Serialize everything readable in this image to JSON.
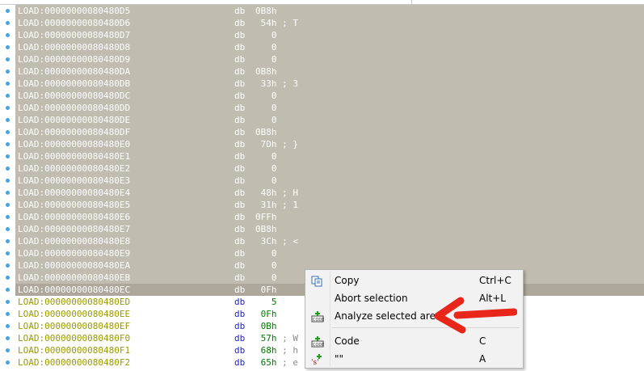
{
  "listing": {
    "rows": [
      {
        "addr": "LOAD:00000000080480D5",
        "mnemonic": "db",
        "operand": "0B8h",
        "comment": "",
        "state": "sel"
      },
      {
        "addr": "LOAD:00000000080480D6",
        "mnemonic": "db",
        "operand": " 54h",
        "comment": " ; T",
        "state": "sel"
      },
      {
        "addr": "LOAD:00000000080480D7",
        "mnemonic": "db",
        "operand": "   0",
        "comment": "",
        "state": "sel"
      },
      {
        "addr": "LOAD:00000000080480D8",
        "mnemonic": "db",
        "operand": "   0",
        "comment": "",
        "state": "sel"
      },
      {
        "addr": "LOAD:00000000080480D9",
        "mnemonic": "db",
        "operand": "   0",
        "comment": "",
        "state": "sel"
      },
      {
        "addr": "LOAD:00000000080480DA",
        "mnemonic": "db",
        "operand": "0B8h",
        "comment": "",
        "state": "sel"
      },
      {
        "addr": "LOAD:00000000080480DB",
        "mnemonic": "db",
        "operand": " 33h",
        "comment": " ; 3",
        "state": "sel"
      },
      {
        "addr": "LOAD:00000000080480DC",
        "mnemonic": "db",
        "operand": "   0",
        "comment": "",
        "state": "sel"
      },
      {
        "addr": "LOAD:00000000080480DD",
        "mnemonic": "db",
        "operand": "   0",
        "comment": "",
        "state": "sel"
      },
      {
        "addr": "LOAD:00000000080480DE",
        "mnemonic": "db",
        "operand": "   0",
        "comment": "",
        "state": "sel"
      },
      {
        "addr": "LOAD:00000000080480DF",
        "mnemonic": "db",
        "operand": "0B8h",
        "comment": "",
        "state": "sel"
      },
      {
        "addr": "LOAD:00000000080480E0",
        "mnemonic": "db",
        "operand": " 7Dh",
        "comment": " ; }",
        "state": "sel"
      },
      {
        "addr": "LOAD:00000000080480E1",
        "mnemonic": "db",
        "operand": "   0",
        "comment": "",
        "state": "sel"
      },
      {
        "addr": "LOAD:00000000080480E2",
        "mnemonic": "db",
        "operand": "   0",
        "comment": "",
        "state": "sel"
      },
      {
        "addr": "LOAD:00000000080480E3",
        "mnemonic": "db",
        "operand": "   0",
        "comment": "",
        "state": "sel"
      },
      {
        "addr": "LOAD:00000000080480E4",
        "mnemonic": "db",
        "operand": " 48h",
        "comment": " ; H",
        "state": "sel"
      },
      {
        "addr": "LOAD:00000000080480E5",
        "mnemonic": "db",
        "operand": " 31h",
        "comment": " ; 1",
        "state": "sel"
      },
      {
        "addr": "LOAD:00000000080480E6",
        "mnemonic": "db",
        "operand": "0FFh",
        "comment": "",
        "state": "sel"
      },
      {
        "addr": "LOAD:00000000080480E7",
        "mnemonic": "db",
        "operand": "0B8h",
        "comment": "",
        "state": "sel"
      },
      {
        "addr": "LOAD:00000000080480E8",
        "mnemonic": "db",
        "operand": " 3Ch",
        "comment": " ; <",
        "state": "sel"
      },
      {
        "addr": "LOAD:00000000080480E9",
        "mnemonic": "db",
        "operand": "   0",
        "comment": "",
        "state": "sel"
      },
      {
        "addr": "LOAD:00000000080480EA",
        "mnemonic": "db",
        "operand": "   0",
        "comment": "",
        "state": "sel"
      },
      {
        "addr": "LOAD:00000000080480EB",
        "mnemonic": "db",
        "operand": "   0",
        "comment": "",
        "state": "sel"
      },
      {
        "addr": "LOAD:00000000080480EC",
        "mnemonic": "db",
        "operand": " 0Fh",
        "comment": "",
        "state": "cur"
      },
      {
        "addr": "LOAD:00000000080480ED",
        "mnemonic": "db",
        "operand": "   5",
        "comment": "",
        "state": "norm"
      },
      {
        "addr": "LOAD:00000000080480EE",
        "mnemonic": "db",
        "operand": " 0Fh",
        "comment": "",
        "state": "norm"
      },
      {
        "addr": "LOAD:00000000080480EF",
        "mnemonic": "db",
        "operand": " 0Bh",
        "comment": "",
        "state": "norm"
      },
      {
        "addr": "LOAD:00000000080480F0",
        "mnemonic": "db",
        "operand": " 57h",
        "comment": " ; W",
        "state": "norm"
      },
      {
        "addr": "LOAD:00000000080480F1",
        "mnemonic": "db",
        "operand": " 68h",
        "comment": " ; h",
        "state": "norm"
      },
      {
        "addr": "LOAD:00000000080480F2",
        "mnemonic": "db",
        "operand": " 65h",
        "comment": " ; e",
        "state": "norm"
      }
    ]
  },
  "context_menu": {
    "items": [
      {
        "label": "Copy",
        "shortcut": "Ctrl+C",
        "icon": "copy-icon"
      },
      {
        "label": "Abort selection",
        "shortcut": "Alt+L",
        "icon": ""
      },
      {
        "label": "Analyze selected area",
        "shortcut": "",
        "icon": "code-plus-icon"
      },
      {
        "label": "Code",
        "shortcut": "C",
        "icon": "code-plus-icon"
      },
      {
        "label": "\"\"",
        "shortcut": "A",
        "icon": "string-plus-icon"
      }
    ]
  },
  "colors": {
    "selection": "#c0bcaf",
    "current_line": "#ada89b",
    "address": "#9a9a00",
    "mnemonic": "#1e1ec8",
    "operand": "#007a00",
    "arrow": "#e8261a",
    "breakpoint_dot": "#3da6e8"
  }
}
